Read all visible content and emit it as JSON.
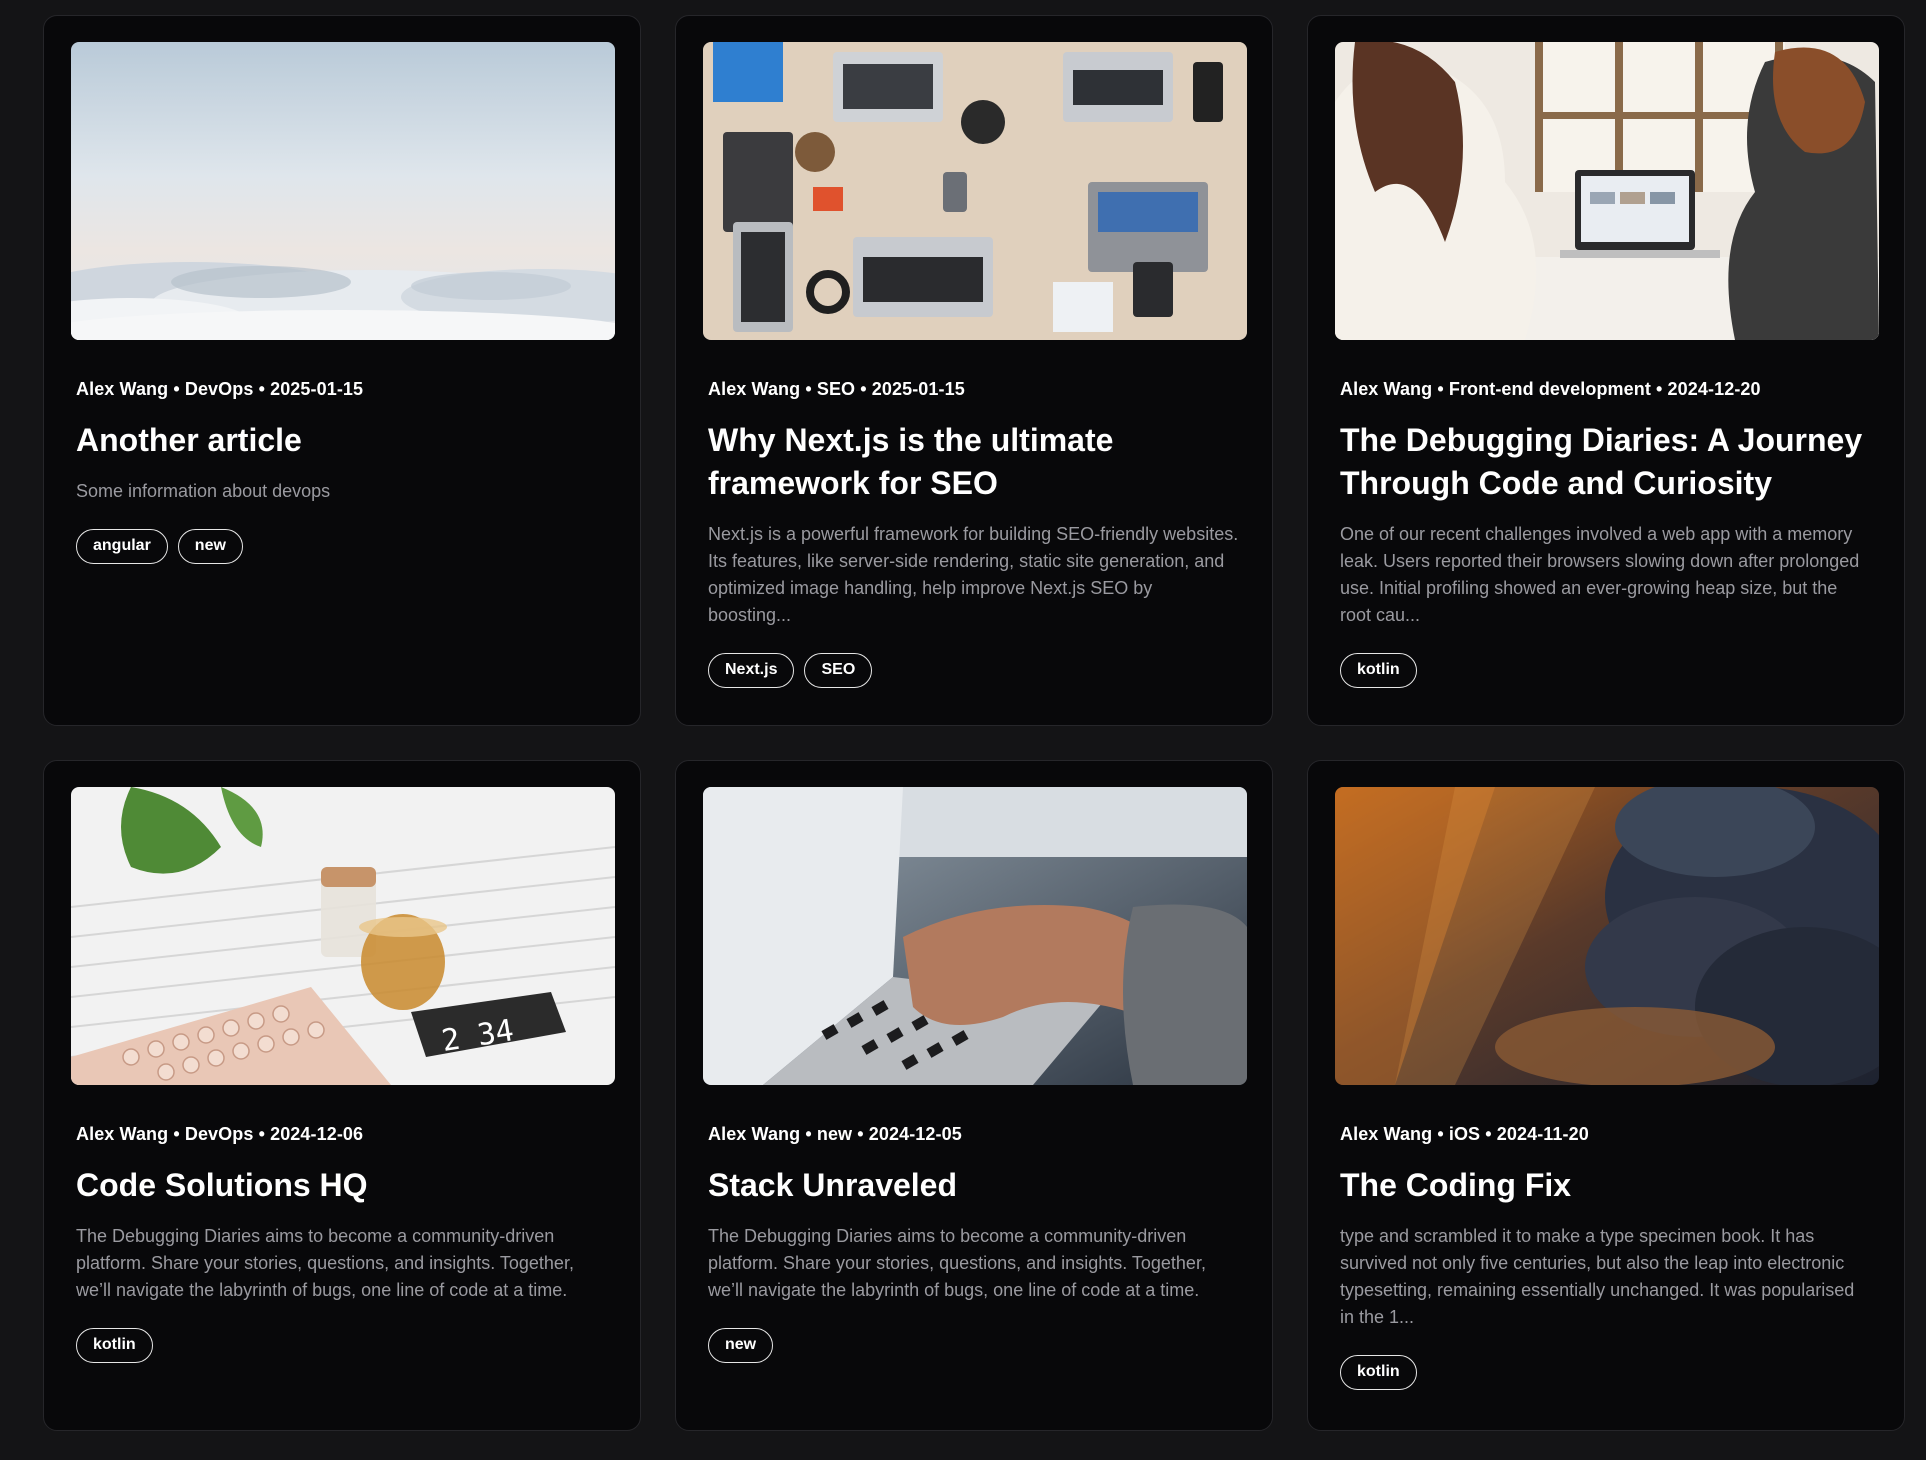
{
  "posts": [
    {
      "meta": "Alex Wang • DevOps • 2025-01-15",
      "title": "Another article",
      "excerpt": "Some information about devops",
      "tags": [
        "angular",
        "new"
      ],
      "image_icon": "clouds-sky-image"
    },
    {
      "meta": "Alex Wang • SEO • 2025-01-15",
      "title": "Why Next.js is the ultimate framework for SEO",
      "excerpt": "Next.js is a powerful framework for building SEO-friendly websites. Its features, like server-side rendering, static site generation, and optimized image handling, help improve Next.js SEO by boosting...",
      "tags": [
        "Next.js",
        "SEO"
      ],
      "image_icon": "laptops-desk-image"
    },
    {
      "meta": "Alex Wang • Front-end development • 2024-12-20",
      "title": "The Debugging Diaries: A Journey Through Code and Curiosity",
      "excerpt": "One of our recent challenges involved a web app with a memory leak. Users reported their browsers slowing down after prolonged use. Initial profiling showed an ever-growing heap size, but the root cau...",
      "tags": [
        "kotlin"
      ],
      "image_icon": "women-laptop-image"
    },
    {
      "meta": "Alex Wang • DevOps • 2024-12-06",
      "title": "Code Solutions HQ",
      "excerpt": "The Debugging Diaries aims to become a community-driven platform. Share your stories, questions, and insights. Together, we’ll navigate the labyrinth of bugs, one line of code at a time.",
      "tags": [
        "kotlin"
      ],
      "image_icon": "keyboard-tea-image",
      "image_text": "2 34"
    },
    {
      "meta": "Alex Wang • new • 2024-12-05",
      "title": "Stack Unraveled",
      "excerpt": "The Debugging Diaries aims to become a community-driven platform. Share your stories, questions, and insights. Together, we’ll navigate the labyrinth of bugs, one line of code at a time.",
      "tags": [
        "new"
      ],
      "image_icon": "typing-laptop-image"
    },
    {
      "meta": "Alex Wang • iOS • 2024-11-20",
      "title": "The Coding Fix",
      "excerpt": "type and scrambled it to make a type specimen book. It has survived not only five centuries, but also the leap into electronic typesetting, remaining essentially unchanged. It was popularised in the 1...",
      "tags": [
        "kotlin"
      ],
      "image_icon": "sunset-clouds-image"
    }
  ]
}
